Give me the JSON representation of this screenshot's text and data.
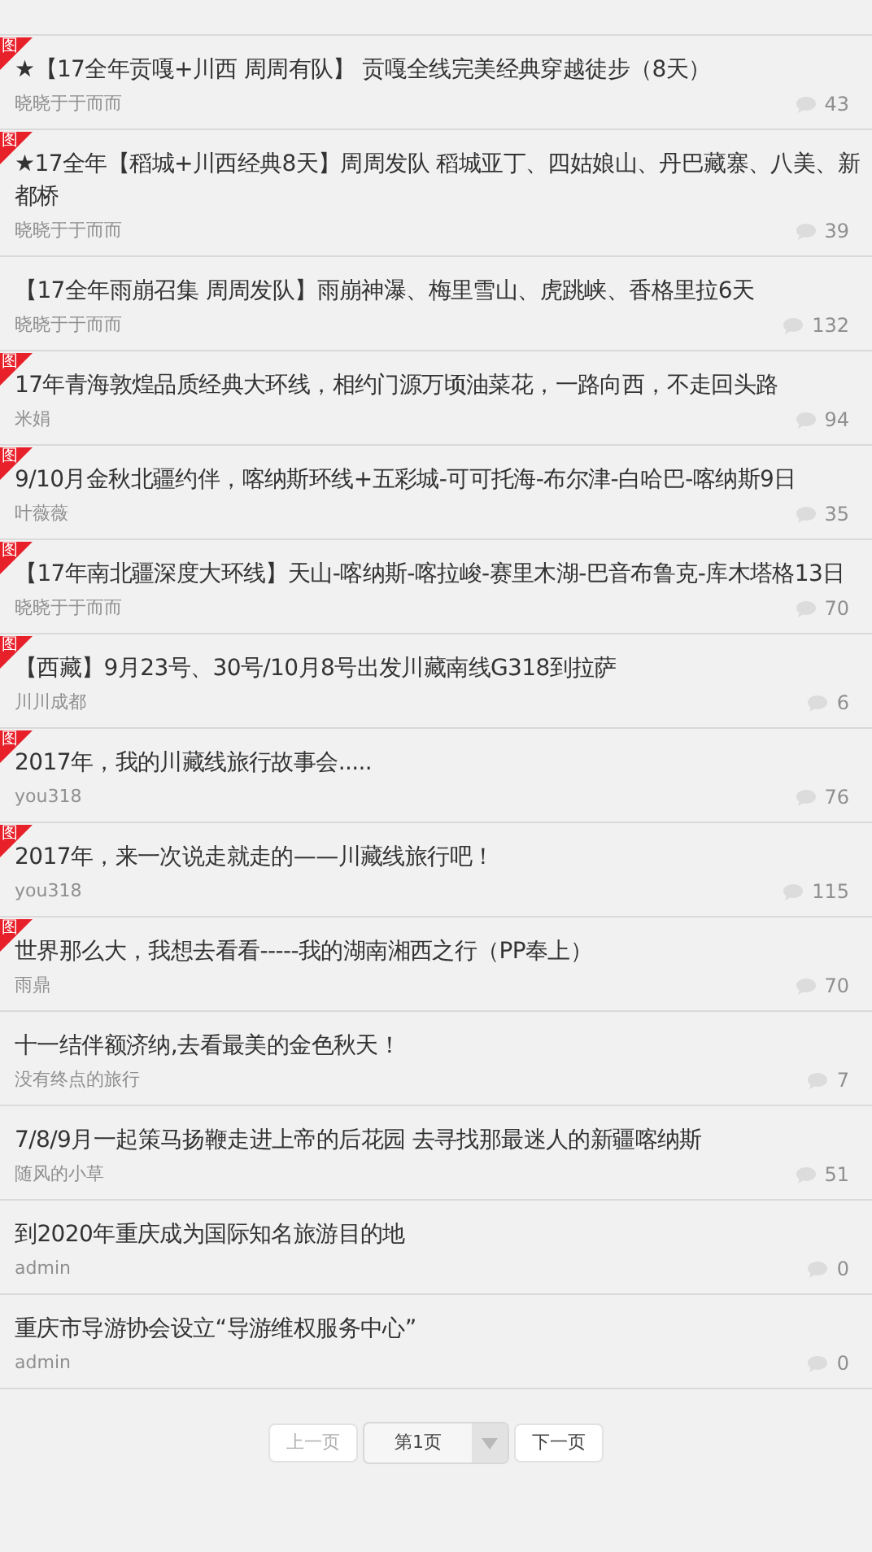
{
  "posts": [
    {
      "badge": "图",
      "title": "★【17全年贡嘎+川西 周周有队】 贡嘎全线完美经典穿越徒步（8天）",
      "author": "晓晓于于而而",
      "comments": "43"
    },
    {
      "badge": "图",
      "title": "★17全年【稻城+川西经典8天】周周发队 稻城亚丁、四姑娘山、丹巴藏寨、八美、新都桥",
      "author": "晓晓于于而而",
      "comments": "39"
    },
    {
      "title": "【17全年雨崩召集 周周发队】雨崩神瀑、梅里雪山、虎跳峡、香格里拉6天",
      "author": "晓晓于于而而",
      "comments": "132"
    },
    {
      "badge": "图",
      "title": "17年青海敦煌品质经典大环线，相约门源万顷油菜花，一路向西，不走回头路",
      "author": "米娟",
      "comments": "94"
    },
    {
      "badge": "图",
      "title": "9/10月金秋北疆约伴，喀纳斯环线+五彩城-可可托海-布尔津-白哈巴-喀纳斯9日",
      "author": "叶薇薇",
      "comments": "35"
    },
    {
      "badge": "图",
      "title": "【17年南北疆深度大环线】天山-喀纳斯-喀拉峻-赛里木湖-巴音布鲁克-库木塔格13日",
      "author": "晓晓于于而而",
      "comments": "70"
    },
    {
      "badge": "图",
      "title": "【西藏】9月23号、30号/10月8号出发川藏南线G318到拉萨",
      "author": "川川成都",
      "comments": "6"
    },
    {
      "badge": "图",
      "title": "2017年，我的川藏线旅行故事会.....",
      "author": "you318",
      "comments": "76"
    },
    {
      "badge": "图",
      "title": "2017年，来一次说走就走的——川藏线旅行吧！",
      "author": "you318",
      "comments": "115"
    },
    {
      "badge": "图",
      "title": "世界那么大，我想去看看-----我的湖南湘西之行（PP奉上）",
      "author": "雨鼎",
      "comments": "70"
    },
    {
      "title": "十一结伴额济纳,去看最美的金色秋天！",
      "author": "没有终点的旅行",
      "comments": "7"
    },
    {
      "title": "7/8/9月一起策马扬鞭走进上帝的后花园 去寻找那最迷人的新疆喀纳斯",
      "author": "随风的小草",
      "comments": "51"
    },
    {
      "title": "到2020年重庆成为国际知名旅游目的地",
      "author": "admin",
      "comments": "0"
    },
    {
      "title": "重庆市导游协会设立“导游维权服务中心”",
      "author": "admin",
      "comments": "0"
    }
  ],
  "pagination": {
    "previous": {
      "label": "上一页",
      "disabled": true
    },
    "page_select": "第1页",
    "next": {
      "label": "下一页",
      "disabled": false
    }
  }
}
